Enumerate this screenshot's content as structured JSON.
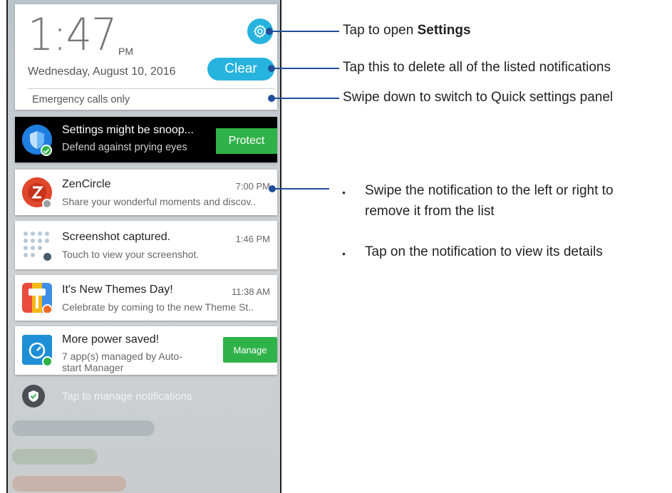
{
  "lockscreen": {
    "time": "1:47",
    "ampm": "PM",
    "date": "Wednesday, August 10, 2016",
    "clear_label": "Clear",
    "emergency_text": "Emergency calls only",
    "settings_icon": "gear-icon"
  },
  "notifications": {
    "security": {
      "title": "Settings might be snoop...",
      "text": "Defend against prying eyes",
      "button": "Protect"
    },
    "zencircle": {
      "title": "ZenCircle",
      "time": "7:00 PM",
      "text": "Share your wonderful moments and discov.."
    },
    "screenshot": {
      "title": "Screenshot captured.",
      "time": "1:46 PM",
      "text": "Touch to view your screenshot."
    },
    "themes": {
      "title": "It's New Themes Day!",
      "time": "11:38 AM",
      "text": "Celebrate by coming to the new Theme St.."
    },
    "power": {
      "title": "More power saved!",
      "text_line1": "7 app(s) managed by Auto-",
      "text_line2": "start Manager",
      "button": "Manage"
    }
  },
  "manage_notifications_text": "Tap to manage notifications",
  "callouts": {
    "settings_prefix": "Tap to open ",
    "settings_bold": "Settings",
    "clear": "Tap this to delete all of the listed notifications",
    "swipe_down": "Swipe down to switch to Quick settings panel",
    "bullet_swipe_line1": "Swipe the notification to the left or right to",
    "bullet_swipe_line2": "remove it from the list",
    "bullet_tap": "Tap on the notification to view its details",
    "bullet_char": "•"
  },
  "colors": {
    "accent": "#26b3dd",
    "callout_line": "#1f4f9a",
    "action_green": "#30b24a"
  }
}
